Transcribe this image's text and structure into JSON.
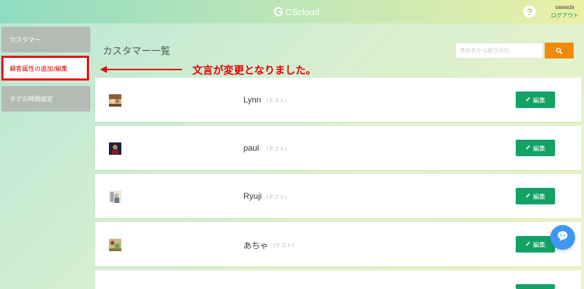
{
  "header": {
    "brand": "CScloud",
    "help": "?",
    "username": "sawada",
    "logout": "ログアウト"
  },
  "sidebar": {
    "items": [
      {
        "label": "カスタマー"
      },
      {
        "label": "顧客属性の追加/編集"
      },
      {
        "label": "タグの時間設定"
      }
    ]
  },
  "main": {
    "title": "カスタマー一覧",
    "search": {
      "placeholder": "表示名から絞り込む",
      "value": ""
    }
  },
  "annotation": {
    "text": "文言が変更となりました。",
    "color": "#e40000"
  },
  "customers": [
    {
      "name": "Lynn",
      "tag": "(テスト)",
      "edit_label": "編集"
    },
    {
      "name": "paul",
      "tag": "(テスト)",
      "edit_label": "編集"
    },
    {
      "name": "Ryuji",
      "tag": "(テスト)",
      "edit_label": "編集"
    },
    {
      "name": "あちゃ",
      "tag": "(テスト)",
      "edit_label": "編集"
    }
  ],
  "colors": {
    "accent_green": "#11a264",
    "search_orange": "#ef8a0a",
    "chat_blue": "#3d97f4",
    "highlight_red": "#ee0000"
  },
  "icons": {
    "brand": "cscloud-logo-icon",
    "help": "question-mark-icon",
    "search": "search-icon",
    "edit": "pencil-icon",
    "chat": "chat-bubble-icon"
  }
}
